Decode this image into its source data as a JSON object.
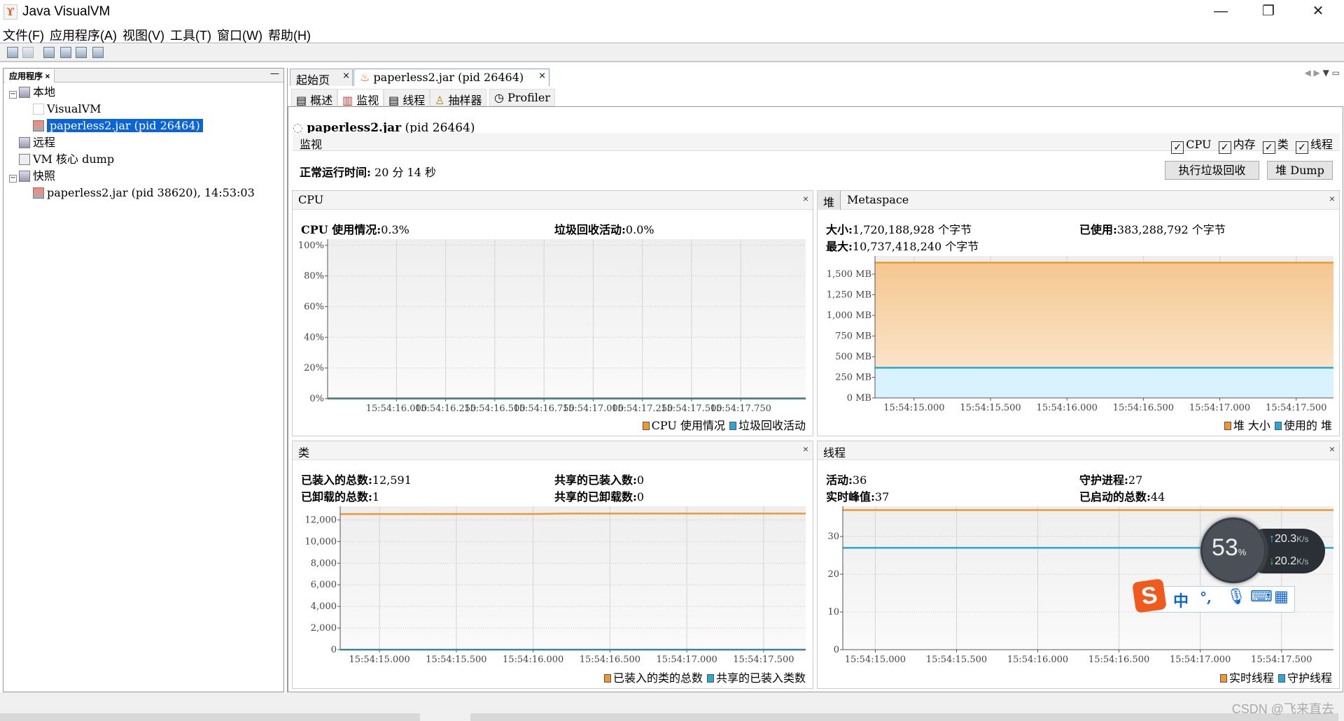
{
  "window": {
    "title": "Java VisualVM",
    "minimize": "—",
    "restore": "❐",
    "close": "✕"
  },
  "menu": [
    "文件(F)",
    "应用程序(A)",
    "视图(V)",
    "工具(T)",
    "窗口(W)",
    "帮助(H)"
  ],
  "left_panel": {
    "tab": "应用程序",
    "tab_close": "×",
    "minimize": "—",
    "tree": [
      {
        "label": "本地",
        "toggle": "−",
        "icon": "computer-icon"
      },
      {
        "label": "VisualVM",
        "icon": "visualvm-icon"
      },
      {
        "label": "paperless2.jar (pid 26464)",
        "icon": "java-app-icon",
        "selected": true
      },
      {
        "label": "远程",
        "icon": "remote-host-icon"
      },
      {
        "label": "VM 核心 dump",
        "icon": "core-dump-icon"
      },
      {
        "label": "快照",
        "toggle": "−",
        "icon": "snapshot-icon"
      },
      {
        "label": "paperless2.jar (pid 38620), 14:53:03",
        "icon": "java-snapshot-icon"
      }
    ]
  },
  "doc_tabs": [
    {
      "label": "起始页",
      "close": "×"
    },
    {
      "label": "paperless2.jar (pid 26464)",
      "close": "×",
      "active": true
    }
  ],
  "sub_tabs": [
    {
      "label": "概述"
    },
    {
      "label": "监视",
      "active": true
    },
    {
      "label": "线程"
    },
    {
      "label": "抽样器"
    },
    {
      "label": "Profiler"
    }
  ],
  "app_title": {
    "name": "paperless2.jar",
    "pid": "(pid 26464)"
  },
  "monitor": {
    "label": "监视",
    "checks": [
      {
        "label": "CPU",
        "checked": true
      },
      {
        "label": "内存",
        "checked": true
      },
      {
        "label": "类",
        "checked": true
      },
      {
        "label": "线程",
        "checked": true
      }
    ],
    "uptime_label": "正常运行时间:",
    "uptime_value": "20 分 14 秒",
    "gc_button": "执行垃圾回收",
    "heapdump_button": "堆 Dump"
  },
  "panels": {
    "cpu": {
      "title": "CPU",
      "close": "×",
      "stats": [
        {
          "label": "CPU 使用情况:",
          "value": "0.3%"
        },
        {
          "label": "垃圾回收活动:",
          "value": "0.0%"
        }
      ]
    },
    "heap": {
      "tabs": [
        "堆",
        "Metaspace"
      ],
      "close": "×",
      "stats": [
        {
          "label": "大小:",
          "value": "1,720,188,928 个字节"
        },
        {
          "label": "已使用:",
          "value": "383,288,792 个字节"
        },
        {
          "label": "最大:",
          "value": "10,737,418,240 个字节"
        }
      ]
    },
    "classes": {
      "title": "类",
      "close": "×",
      "stats": [
        {
          "label": "已装入的总数:",
          "value": "12,591"
        },
        {
          "label": "共享的已装入数:",
          "value": "0"
        },
        {
          "label": "已卸载的总数:",
          "value": "1"
        },
        {
          "label": "共享的已卸载数:",
          "value": "0"
        }
      ]
    },
    "threads": {
      "title": "线程",
      "close": "×",
      "stats": [
        {
          "label": "活动:",
          "value": "36"
        },
        {
          "label": "守护进程:",
          "value": "27"
        },
        {
          "label": "实时峰值:",
          "value": "37"
        },
        {
          "label": "已启动的总数:",
          "value": "44"
        }
      ]
    }
  },
  "chart_data": [
    {
      "id": "cpu",
      "type": "line",
      "xlim": [
        "15:54:15.650",
        "15:54:18.080"
      ],
      "ylim": [
        0,
        104
      ],
      "yticks": [
        0,
        20,
        40,
        60,
        80,
        100
      ],
      "ytick_labels": [
        "0%",
        "20%",
        "40%",
        "60%",
        "80%",
        "100%"
      ],
      "xticks": [
        "15:54:16.000",
        "15:54:16.250",
        "15:54:16.500",
        "15:54:16.750",
        "15:54:17.000",
        "15:54:17.250",
        "15:54:17.500",
        "15:54:17.750"
      ],
      "series": [
        {
          "name": "CPU 使用情况",
          "color": "#f0982e",
          "points": [
            [
              "15:54:15.650",
              0.3
            ],
            [
              "15:54:18.080",
              0.3
            ]
          ]
        },
        {
          "name": "垃圾回收活动",
          "color": "#2aa6d8",
          "points": [
            [
              "15:54:15.650",
              0
            ],
            [
              "15:54:18.080",
              0
            ]
          ]
        }
      ]
    },
    {
      "id": "heap",
      "type": "area",
      "xlim": [
        "15:54:14.744",
        "15:54:17.744"
      ],
      "ylim": [
        0,
        1720
      ],
      "yticks": [
        0,
        250,
        500,
        750,
        1000,
        1250,
        1500
      ],
      "ytick_labels": [
        "0 MB",
        "250 MB",
        "500 MB",
        "750 MB",
        "1,000 MB",
        "1,250 MB",
        "1,500 MB"
      ],
      "xticks": [
        "15:54:15.000",
        "15:54:15.500",
        "15:54:16.000",
        "15:54:16.500",
        "15:54:17.000",
        "15:54:17.500"
      ],
      "series": [
        {
          "name": "堆 大小",
          "color": "#f0982e",
          "fill": "#f6c990",
          "points": [
            [
              "15:54:14.744",
              1640
            ],
            [
              "15:54:17.744",
              1640
            ]
          ]
        },
        {
          "name": "使用的 堆",
          "color": "#2aa6d8",
          "fill": "#d8f3fd",
          "points": [
            [
              "15:54:14.744",
              365
            ],
            [
              "15:54:17.744",
              365
            ]
          ]
        }
      ]
    },
    {
      "id": "classes",
      "type": "line",
      "xlim": [
        "15:54:14.744",
        "15:54:17.774"
      ],
      "ylim": [
        0,
        13260
      ],
      "yticks": [
        0,
        2000,
        4000,
        6000,
        8000,
        10000,
        12000
      ],
      "ytick_labels": [
        "0",
        "2,000",
        "4,000",
        "6,000",
        "8,000",
        "10,000",
        "12,000"
      ],
      "xticks": [
        "15:54:15.000",
        "15:54:15.500",
        "15:54:16.000",
        "15:54:16.500",
        "15:54:17.000",
        "15:54:17.500"
      ],
      "series": [
        {
          "name": "已装入的类的总数",
          "color": "#f0982e",
          "points": [
            [
              "15:54:14.744",
              12540
            ],
            [
              "15:54:16.000",
              12550
            ],
            [
              "15:54:16.200",
              12591
            ],
            [
              "15:54:17.774",
              12591
            ]
          ]
        },
        {
          "name": "共享的已装入类数",
          "color": "#2aa6d8",
          "points": [
            [
              "15:54:14.744",
              0
            ],
            [
              "15:54:17.774",
              0
            ]
          ]
        }
      ]
    },
    {
      "id": "threads",
      "type": "line",
      "xlim": [
        "15:54:14.800",
        "15:54:17.820"
      ],
      "ylim": [
        0,
        38
      ],
      "yticks": [
        0,
        10,
        20,
        30
      ],
      "ytick_labels": [
        "0",
        "10",
        "20",
        "30"
      ],
      "xticks": [
        "15:54:15.000",
        "15:54:15.500",
        "15:54:16.000",
        "15:54:16.500",
        "15:54:17.000",
        "15:54:17.500"
      ],
      "series": [
        {
          "name": "实时线程",
          "color": "#f0982e",
          "points": [
            [
              "15:54:14.800",
              37
            ],
            [
              "15:54:17.820",
              37
            ]
          ]
        },
        {
          "name": "守护线程",
          "color": "#2aa6d8",
          "points": [
            [
              "15:54:14.800",
              27
            ],
            [
              "15:54:17.820",
              27
            ]
          ]
        }
      ]
    }
  ],
  "overlays": {
    "net_percent": "53",
    "net_percent_unit": "%",
    "upload": "20.3",
    "download": "20.2",
    "speed_unit": "K/s",
    "ime": {
      "mode": "中",
      "punct": "°,"
    },
    "watermark": "CSDN @飞来直去"
  }
}
